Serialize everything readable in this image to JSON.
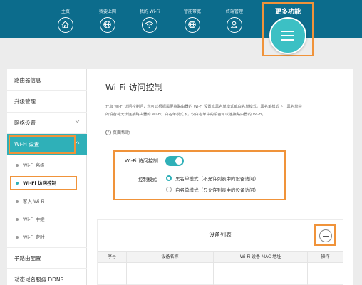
{
  "nav": {
    "items": [
      {
        "label": "主页",
        "icon": "home-icon"
      },
      {
        "label": "我要上网",
        "icon": "globe-icon"
      },
      {
        "label": "我的 Wi-Fi",
        "icon": "wifi-icon"
      },
      {
        "label": "智能带宽",
        "icon": "globe-icon"
      },
      {
        "label": "终端管理",
        "icon": "user-icon"
      }
    ],
    "more": {
      "label": "更多功能",
      "icon": "menu-icon"
    }
  },
  "sidebar": {
    "items": [
      {
        "label": "路由器信息"
      },
      {
        "label": "升级管理"
      },
      {
        "label": "网络设置"
      },
      {
        "label": "Wi-Fi 设置"
      }
    ],
    "sub_items": [
      {
        "label": "Wi-Fi 高级"
      },
      {
        "label": "Wi-Fi 访问控制"
      },
      {
        "label": "客人 Wi-Fi"
      },
      {
        "label": "Wi-Fi 中继"
      },
      {
        "label": "Wi-Fi 定时"
      }
    ],
    "bottom_items": [
      {
        "label": "子路由配置"
      },
      {
        "label": "动态域名服务 DDNS"
      }
    ]
  },
  "main": {
    "title": "Wi-Fi 访问控制",
    "description_line1": "开启 Wi-Fi 访问控制后，您可以根据需要将路由器的 Wi-Fi 设置成黑名单模式或白名单模式。黑名单模式下，黑名单中",
    "description_line2": "的设备将无法连接路由器的 Wi-Fi；白名单模式下，仅白名单中的设备可以连接路由器的 Wi-Fi。",
    "help_link": "页面帮助",
    "help_symbol": "?",
    "access_control_label": "Wi-Fi 访问控制",
    "access_control_on": true,
    "mode_label": "控制模式",
    "mode_options": [
      {
        "label": "黑名单模式（不允许列表中的设备访问）",
        "selected": true
      },
      {
        "label": "白名单模式（只允许列表中的设备访问）",
        "selected": false
      }
    ],
    "device_list": {
      "title": "设备列表",
      "columns": [
        "序号",
        "设备名称",
        "Wi-Fi 设备 MAC 地址",
        "操作"
      ]
    }
  },
  "colors": {
    "nav_bg": "#0c6c8c",
    "accent_teal": "#2fb0b8",
    "highlight_orange": "#f0933a"
  }
}
